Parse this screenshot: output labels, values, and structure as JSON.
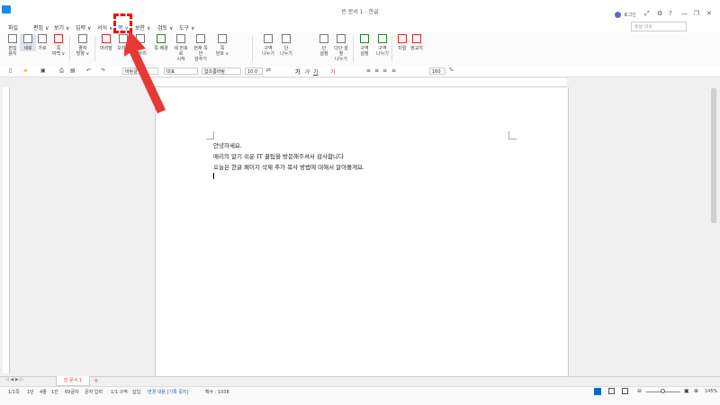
{
  "window": {
    "title": "빈 문서 1 - 한글",
    "login": "로그인",
    "controls": [
      "⤢",
      "⚙",
      "?",
      "—",
      "❐",
      "✕"
    ]
  },
  "menu": {
    "items": [
      "파일",
      "편집 ∨",
      "보기 ∨",
      "입력 ∨",
      "서식 ∨",
      "쪽 ∨",
      "보안 ∨",
      "검토 ∨",
      "도구 ∨"
    ],
    "search_placeholder": "찾을 내용"
  },
  "ribbon": {
    "buttons": [
      {
        "label": "편집\n용지"
      },
      {
        "label": "세로"
      },
      {
        "label": "가로"
      },
      {
        "label": "쪽\n여백 ∨"
      },
      {
        "label": "줄자\n방향 ∨"
      },
      {
        "label": "머리말"
      },
      {
        "label": "꼬리말"
      },
      {
        "label": "쪽\n테두리"
      },
      {
        "label": "쪽 배경"
      },
      {
        "label": "새 번호로\n시작"
      },
      {
        "label": "현재 쪽만\n감추기"
      },
      {
        "label": "쪽\n번호 ∨"
      },
      {
        "label": "구역\n나누기"
      },
      {
        "label": "단\n나누기"
      },
      {
        "label": "단\n설정"
      },
      {
        "label": "다단 설정\n나누기"
      },
      {
        "label": "구역\n설정"
      },
      {
        "label": "구역\n나누기"
      },
      {
        "label": "미릴"
      },
      {
        "label": "정교지"
      }
    ]
  },
  "format": {
    "style": "바탕글",
    "language": "대표",
    "font": "함초롬바탕",
    "size": "10.0",
    "unit": "pt",
    "line_spacing": "160",
    "percent": "%"
  },
  "document": {
    "lines": [
      "안녕하세요.",
      "메리의 알기 쉬운 IT 꿀팁을 방문해주셔서 감사합니다",
      "오늘은 한글 페이지 삭제 추가 복사 방법에 대해서 알아볼게요."
    ]
  },
  "tabs": {
    "doc_tab": "빈 문서 1",
    "add": "+"
  },
  "status": {
    "page": "1/1쪽",
    "section": "1단",
    "line": "4줄",
    "col": "1칸",
    "chars": "69글자",
    "mode": "문자 입력",
    "sect": "1/1 구역",
    "insert": "삽입",
    "change_track": "변경 내용 [기록 중지]",
    "hidden": "확수 : 1038",
    "zoom": "145%"
  },
  "accents": {
    "annotation": "#ff0000",
    "brand": "#1e88e5"
  }
}
